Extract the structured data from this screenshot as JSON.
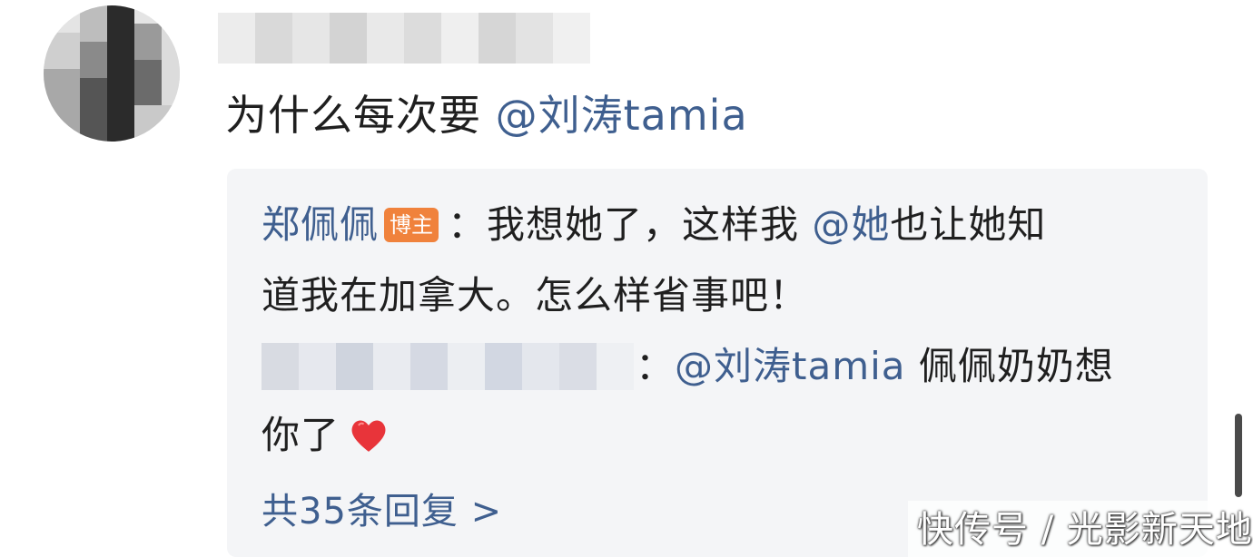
{
  "comment": {
    "username_hidden": true,
    "text_prefix": "为什么每次要 ",
    "mention": "@刘涛tamia"
  },
  "reply_box": {
    "first_reply": {
      "author": "郑佩佩",
      "badge": "博主",
      "line1": "：我想她了，这样我 ",
      "mention": "@她",
      "line1_end": "也让她知",
      "line2": "道我在加拿大。怎么样省事吧！"
    },
    "second_reply": {
      "author_hidden": true,
      "colon": "：",
      "mention": "@刘涛tamia",
      "line1_end": " 佩佩奶奶想",
      "line2": "你了"
    },
    "more_replies": "共35条回复 >"
  },
  "watermark": "快传号 / 光影新天地",
  "colors": {
    "mention": "#3f5f8f",
    "badge_bg": "#f0823c",
    "reply_bg": "#f4f5f7",
    "text": "#1f1f1f"
  },
  "icons": {
    "heart": "red-heart-icon"
  }
}
